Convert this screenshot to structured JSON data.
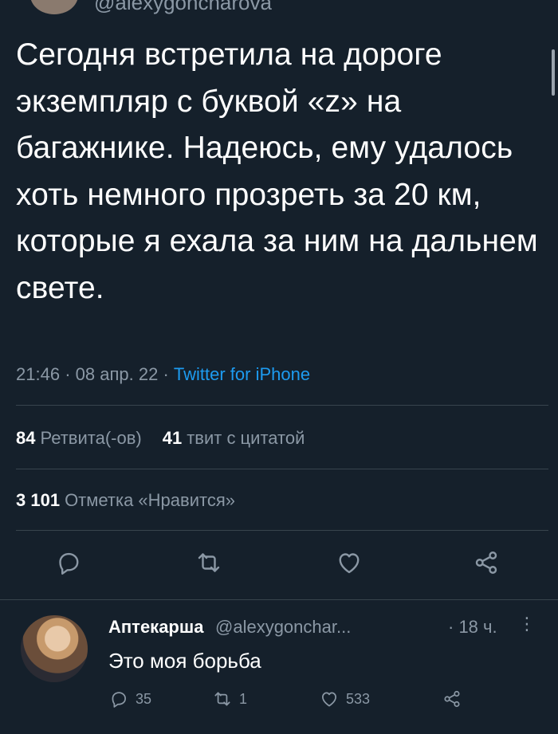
{
  "tweet": {
    "handle_cut": "@alexygoncharova",
    "text": "Сегодня встретила на дороге экземпляр с буквой «z» на багажнике. Надеюсь, ему удалось хоть немного прозреть за 20 км, которые я ехала за ним на дальнем свете.",
    "time": "21:46",
    "date": "08 апр. 22",
    "source": "Twitter for iPhone",
    "retweets_count": "84",
    "retweets_label": "Ретвита(-ов)",
    "quotes_count": "41",
    "quotes_label": "твит с цитатой",
    "likes_count": "3 101",
    "likes_label": "Отметка «Нравится»"
  },
  "actions": {
    "icons": [
      "reply-icon",
      "retweet-icon",
      "like-icon",
      "share-icon"
    ]
  },
  "reply": {
    "name": "Аптекарша",
    "handle": "@alexygonchar...",
    "time": "· 18 ч.",
    "more": "⋮",
    "text": "Это моя борьба",
    "reply_count": "35",
    "retweet_count": "1",
    "like_count": "533"
  },
  "colors": {
    "background": "#15202b",
    "text": "#ffffff",
    "muted": "#8b98a5",
    "accent": "#1d9bf0",
    "divider": "#38444d"
  }
}
